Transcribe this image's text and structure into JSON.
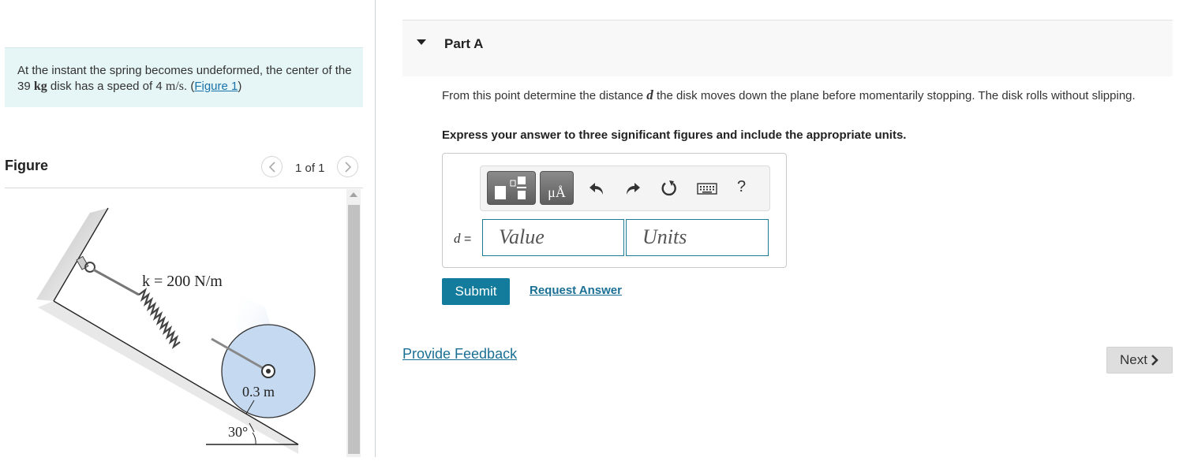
{
  "problem": {
    "text_before": "At the instant the spring becomes undeformed, the center of the 39 ",
    "mass_unit": "kg",
    "text_middle": " disk has a speed of 4 ",
    "speed_unit": "m/s",
    "text_after": ". (",
    "figure_link": "Figure 1",
    "text_close": ")"
  },
  "figure": {
    "title": "Figure",
    "pager": "1 of 1",
    "spring_label": "k = 200 N/m",
    "radius_label": "0.3 m",
    "angle_label": "30°"
  },
  "part": {
    "title": "Part A",
    "question_before": "From this point determine the distance ",
    "question_var": "d",
    "question_after": " the disk moves down the plane before momentarily stopping. The disk rolls without slipping.",
    "instruction": "Express your answer to three significant figures and include the appropriate units.",
    "units_button": "μÅ",
    "help_button": "?",
    "answer_var": "d",
    "answer_eq": " =",
    "value_placeholder": "Value",
    "units_placeholder": "Units",
    "submit_label": "Submit",
    "request_label": "Request Answer"
  },
  "footer": {
    "feedback_label": "Provide Feedback",
    "next_label": "Next"
  },
  "icons": [
    "chevron-left-icon",
    "chevron-right-icon",
    "caret-down-icon",
    "templates-icon",
    "undo-icon",
    "redo-icon",
    "reset-icon",
    "keyboard-icon",
    "chevron-right-icon"
  ],
  "colors": {
    "accent": "#137b9b",
    "link": "#1a6f94",
    "problem_bg": "#e6f5f6",
    "disk": "#c5d9f0"
  }
}
